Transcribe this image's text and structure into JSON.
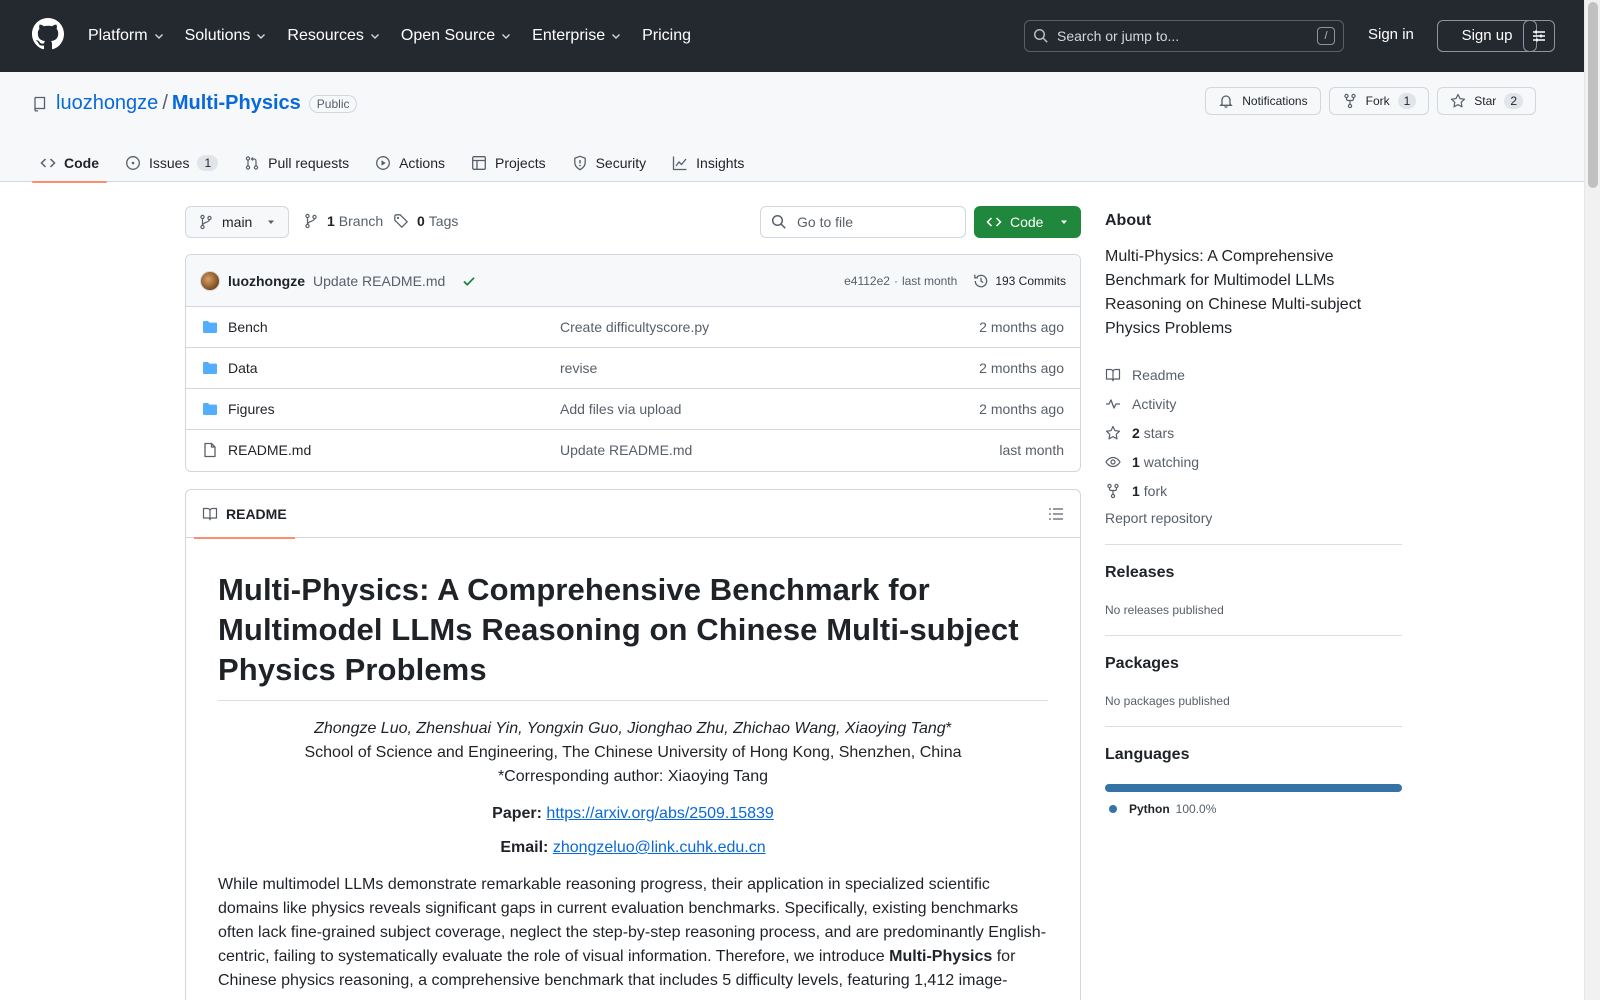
{
  "header": {
    "nav": [
      "Platform",
      "Solutions",
      "Resources",
      "Open Source",
      "Enterprise",
      "Pricing"
    ],
    "search_placeholder": "Search or jump to...",
    "search_shortcut": "/",
    "signin": "Sign in",
    "signup": "Sign up"
  },
  "repo": {
    "owner": "luozhongze",
    "separator": "/",
    "name": "Multi-Physics",
    "visibility": "Public",
    "notifications": "Notifications",
    "fork_label": "Fork",
    "fork_count": "1",
    "star_label": "Star",
    "star_count": "2"
  },
  "tabs": [
    {
      "label": "Code"
    },
    {
      "label": "Issues",
      "count": "1"
    },
    {
      "label": "Pull requests"
    },
    {
      "label": "Actions"
    },
    {
      "label": "Projects"
    },
    {
      "label": "Security"
    },
    {
      "label": "Insights"
    }
  ],
  "toolbar": {
    "branch": "main",
    "branch_count": "1",
    "branch_label": "Branch",
    "tag_count": "0",
    "tag_label": "Tags",
    "goto_placeholder": "Go to file",
    "code_button": "Code"
  },
  "commit": {
    "author": "luozhongze",
    "message": "Update README.md",
    "sha": "e4112e2",
    "sep": "·",
    "time": "last month",
    "commits": "193 Commits"
  },
  "files": [
    {
      "name": "Bench",
      "type": "folder",
      "message": "Create difficultyscore.py",
      "age": "2 months ago"
    },
    {
      "name": "Data",
      "type": "folder",
      "message": "revise",
      "age": "2 months ago"
    },
    {
      "name": "Figures",
      "type": "folder",
      "message": "Add files via upload",
      "age": "2 months ago"
    },
    {
      "name": "README.md",
      "type": "file",
      "message": "Update README.md",
      "age": "last month"
    }
  ],
  "readme": {
    "tab_label": "README",
    "title": "Multi-Physics: A Comprehensive Benchmark for Multimodel LLMs Reasoning on Chinese Multi-subject Physics Problems",
    "authors": "Zhongze Luo, Zhenshuai Yin, Yongxin Guo, Jionghao Zhu, Zhichao Wang, Xiaoying Tang",
    "authors_mark": "*",
    "affiliation": "School of Science and Engineering, The Chinese University of Hong Kong, Shenzhen, China",
    "corresponding": "*Corresponding author: Xiaoying Tang",
    "paper_label": "Paper:",
    "paper_link": "https://arxiv.org/abs/2509.15839",
    "email_label": "Email:",
    "email_link": "zhongzeluo@link.cuhk.edu.cn",
    "abstract_a": "While multimodel LLMs demonstrate remarkable reasoning progress, their application in specialized scientific domains like physics reveals significant gaps in current evaluation benchmarks. Specifically, existing benchmarks often lack fine-grained subject coverage, neglect the step-by-step reasoning process, and are predominantly English-centric, failing to systematically evaluate the role of visual information. Therefore, we introduce ",
    "abstract_bold": "Multi-Physics",
    "abstract_b": " for Chinese physics reasoning, a comprehensive benchmark that includes 5 difficulty levels, featuring 1,412 image-"
  },
  "about": {
    "heading": "About",
    "description": "Multi-Physics: A Comprehensive Benchmark for Multimodel LLMs Reasoning on Chinese Multi-subject Physics Problems",
    "readme": "Readme",
    "activity": "Activity",
    "stars_count": "2",
    "stars_label": "stars",
    "watching_count": "1",
    "watching_label": "watching",
    "fork_count": "1",
    "fork_label": "fork",
    "report": "Report repository"
  },
  "releases": {
    "heading": "Releases",
    "text": "No releases published"
  },
  "packages": {
    "heading": "Packages",
    "text": "No packages published"
  },
  "languages": {
    "heading": "Languages",
    "items": [
      {
        "name": "Python",
        "pct": "100.0%",
        "share": 1.0,
        "color": "#3572a5"
      }
    ]
  },
  "colors": {
    "header_bg": "#24292f",
    "link": "#0969da",
    "code_btn": "#1f883d",
    "tab_underline": "#fd8c73",
    "folder": "#54aeff"
  }
}
